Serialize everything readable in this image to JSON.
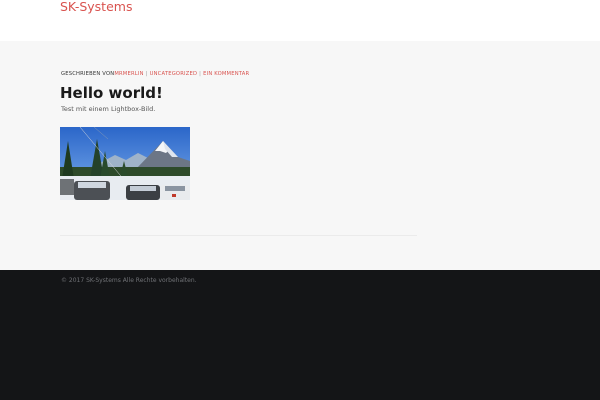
{
  "header": {
    "site_title": "SK-Systems"
  },
  "post": {
    "meta": {
      "written_by": "Geschrieben von",
      "author": "MrMerlin",
      "separator": "|",
      "category": "Uncategorized",
      "comments": "Ein Kommentar"
    },
    "title": "Hello world!",
    "text": "Test mit einem Lightbox-Bild."
  },
  "footer": {
    "copyright": "© 2017 SK-Systems Alle Rechte vorbehalten."
  },
  "colors": {
    "accent": "#d9534f",
    "footer_bg": "#141517",
    "content_bg": "#f7f7f7"
  }
}
